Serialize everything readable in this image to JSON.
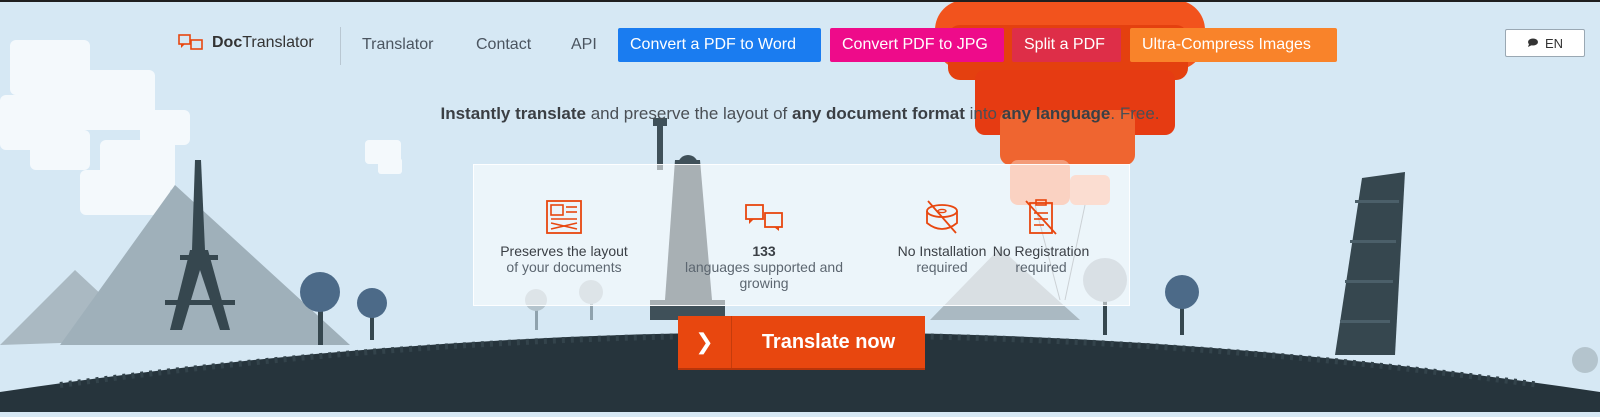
{
  "brand": {
    "name_bold": "Doc",
    "name_rest": "Translator"
  },
  "nav": {
    "links": [
      "Translator",
      "Contact",
      "API"
    ],
    "pills": [
      {
        "label": "Convert a PDF to Word",
        "color": "#1a7cf0"
      },
      {
        "label": "Convert PDF to JPG",
        "color": "#ee0b8a"
      },
      {
        "label": "Split a PDF",
        "color": "#de2e48"
      },
      {
        "label": "Ultra-Compress Images",
        "color": "#f9832a"
      }
    ],
    "language": "EN"
  },
  "tagline": {
    "part1": "Instantly translate",
    "part2": " and preserve the layout of ",
    "part3": "any document format",
    "part4": " into ",
    "part5": "any language",
    "part6": ". Free."
  },
  "features": [
    {
      "icon": "layout-icon",
      "title": "Preserves the layout",
      "subtitle": "of your documents"
    },
    {
      "icon": "languages-icon",
      "title": "133",
      "subtitle": "languages supported and growing"
    },
    {
      "icon": "no-installation-icon",
      "title": "No Installation",
      "subtitle": "required"
    },
    {
      "icon": "no-registration-icon",
      "title": "No Registration",
      "subtitle": "required"
    }
  ],
  "cta": {
    "label": "Translate now",
    "arrow": "❯"
  },
  "colors": {
    "accent": "#e8470f",
    "sky": "#d6e8f4",
    "ground": "#26343c"
  }
}
